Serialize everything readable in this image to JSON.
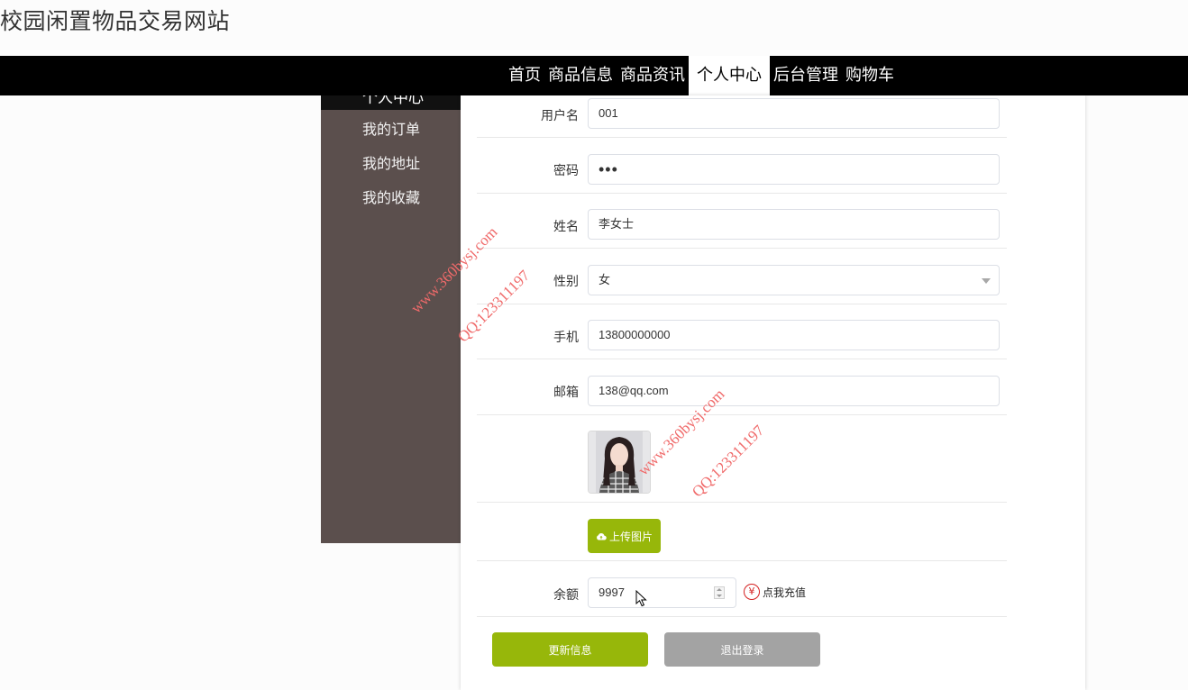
{
  "site": {
    "title": "校园闲置物品交易网站"
  },
  "nav": {
    "items": [
      {
        "label": "首页",
        "active": false
      },
      {
        "label": "商品信息",
        "active": false
      },
      {
        "label": "商品资讯",
        "active": false
      },
      {
        "label": "个人中心",
        "active": true
      },
      {
        "label": "后台管理",
        "active": false
      },
      {
        "label": "购物车",
        "active": false
      }
    ]
  },
  "sidebar": {
    "heading": "个人中心",
    "items": [
      {
        "label": "我的订单"
      },
      {
        "label": "我的地址"
      },
      {
        "label": "我的收藏"
      }
    ]
  },
  "form": {
    "username": {
      "label": "用户名",
      "value": "001"
    },
    "password": {
      "label": "密码",
      "value": "•••"
    },
    "name": {
      "label": "姓名",
      "value": "李女士"
    },
    "gender": {
      "label": "性别",
      "value": "女"
    },
    "phone": {
      "label": "手机",
      "value": "13800000000"
    },
    "email": {
      "label": "邮箱",
      "value": "138@qq.com"
    },
    "upload_label": "上传图片",
    "balance": {
      "label": "余额",
      "value": "9997"
    },
    "recharge_label": "点我充值",
    "recharge_icon": "¥",
    "update_label": "更新信息",
    "logout_label": "退出登录"
  },
  "watermarks": {
    "site": "www.360bysj.com",
    "qq": "QQ:123311197"
  },
  "colors": {
    "nav_bg": "#000000",
    "sidebar_bg": "#5b4f4d",
    "primary_button": "#97b70a",
    "secondary_button": "#a3a3a3",
    "watermark": "#f06a6a",
    "recharge_icon": "#d42020"
  },
  "icons": {
    "upload": "cloud-upload-icon",
    "recharge": "yen-circle-icon",
    "select": "chevron-down-icon",
    "cursor": "mouse-pointer-icon"
  }
}
